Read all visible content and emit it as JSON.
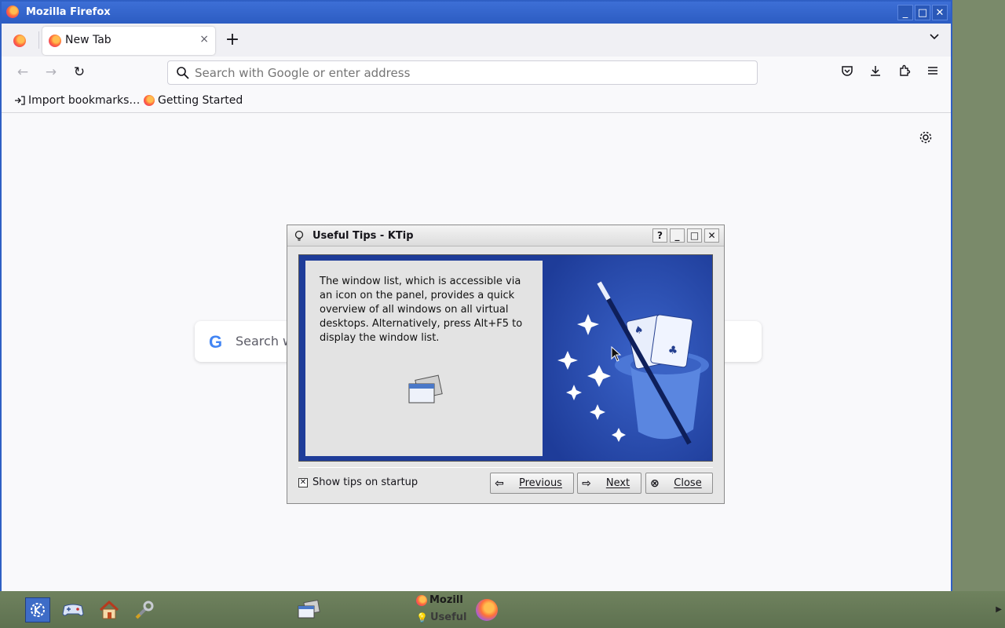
{
  "window": {
    "title": "Mozilla Firefox",
    "buttons": {
      "minimize": "_",
      "maximize": "□",
      "close": "✕"
    }
  },
  "tabs": {
    "active_label": "New Tab",
    "close_glyph": "×",
    "new_tab_glyph": "+",
    "list_glyph": "⌄"
  },
  "nav": {
    "back_glyph": "←",
    "forward_glyph": "→",
    "reload_glyph": "↻",
    "url_placeholder": "Search with Google or enter address"
  },
  "bookmarks": {
    "items": [
      {
        "label": "Import bookmarks…",
        "icon": "import-icon"
      },
      {
        "label": "Getting Started",
        "icon": "firefox-icon"
      }
    ]
  },
  "content": {
    "google_search_placeholder": "Search w",
    "google_logo": "G"
  },
  "ktip": {
    "title": "Useful Tips - KTip",
    "tip_text": "The window list, which is accessible via an icon on the panel, provides a quick overview of all windows on all virtual desktops. Alternatively, press Alt+F5 to display the window list.",
    "show_on_startup_label": "Show tips on startup",
    "show_on_startup_checked": true,
    "buttons": {
      "previous": "Previous",
      "next": "Next",
      "close": "Close"
    },
    "titlebar_buttons": {
      "help": "?",
      "minimize": "_",
      "maximize": "□",
      "close": "✕"
    }
  },
  "taskbar": {
    "tasks": [
      {
        "label": "Mozill",
        "icon": "firefox-icon"
      },
      {
        "label": "Useful",
        "icon": "bulb-icon"
      }
    ]
  },
  "colors": {
    "titlebar": "#2c5cc2",
    "tip_background": "#1e3c99",
    "taskbar": "#6f825e"
  }
}
